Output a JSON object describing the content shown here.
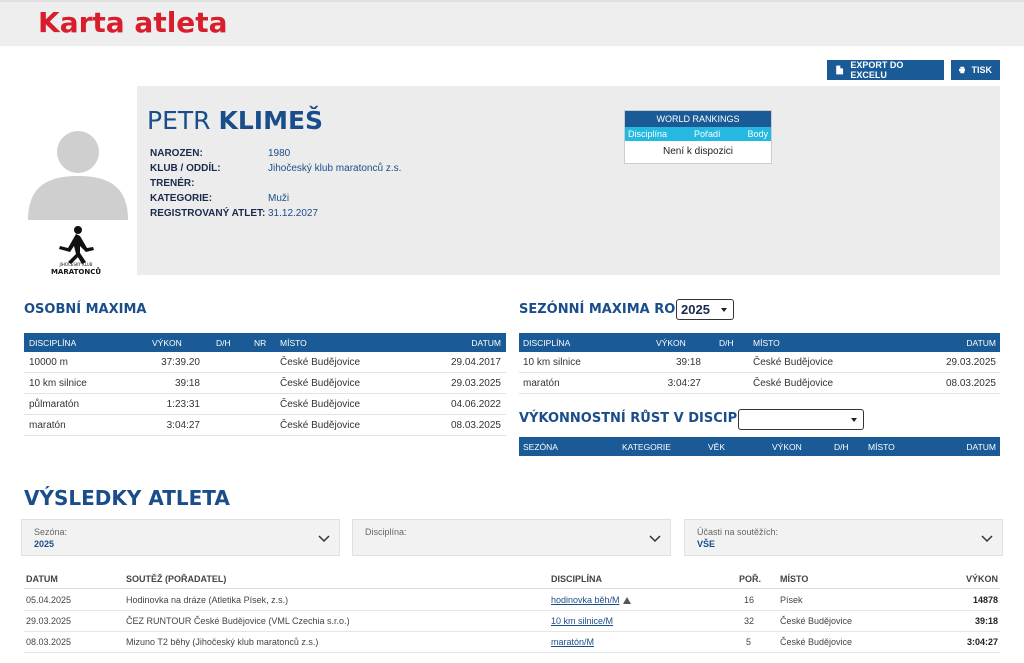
{
  "header": {
    "title": "Karta atleta"
  },
  "toolbar": {
    "export_label": "EXPORT DO EXCELU",
    "print_label": "TISK"
  },
  "athlete": {
    "first_name": "PETR",
    "last_name": "KLIMEŠ",
    "fields": [
      {
        "label": "NAROZEN:",
        "value": "1980"
      },
      {
        "label": "KLUB / ODDÍL:",
        "value": "Jihočeský klub maratonců z.s."
      },
      {
        "label": "TRENÉR:",
        "value": ""
      },
      {
        "label": "KATEGORIE:",
        "value": "Muži"
      },
      {
        "label": "REGISTROVANÝ ATLET:",
        "value": "31.12.2027"
      }
    ],
    "club_logo_text": [
      "JIHOČESKÝ KLUB",
      "MARATONCŮ"
    ]
  },
  "world_rankings": {
    "title": "WORLD RANKINGS",
    "columns": [
      "Disciplína",
      "Pořadí",
      "Body"
    ],
    "empty": "Není k dispozici"
  },
  "personal_bests": {
    "title": "OSOBNÍ MAXIMA",
    "columns": [
      "DISCIPLÍNA",
      "VÝKON",
      "D/H",
      "NR",
      "MÍSTO",
      "DATUM"
    ],
    "rows": [
      [
        "10000 m",
        "37:39.20",
        "",
        "",
        "České Budějovice",
        "29.04.2017"
      ],
      [
        "10 km silnice",
        "39:18",
        "",
        "",
        "České Budějovice",
        "29.03.2025"
      ],
      [
        "půlmaratón",
        "1:23:31",
        "",
        "",
        "České Budějovice",
        "04.06.2022"
      ],
      [
        "maratón",
        "3:04:27",
        "",
        "",
        "České Budějovice",
        "08.03.2025"
      ]
    ]
  },
  "season_bests": {
    "title": "SEZÓNNÍ MAXIMA ROKU",
    "year": "2025",
    "columns": [
      "DISCIPLÍNA",
      "VÝKON",
      "D/H",
      "MÍSTO",
      "DATUM"
    ],
    "rows": [
      [
        "10 km silnice",
        "39:18",
        "",
        "České Budějovice",
        "29.03.2025"
      ],
      [
        "maratón",
        "3:04:27",
        "",
        "České Budějovice",
        "08.03.2025"
      ]
    ]
  },
  "progress": {
    "title": "VÝKONNOSTNÍ RŮST V DISCIPLÍNĚ",
    "selected": "",
    "columns": [
      "SEZÓNA",
      "KATEGORIE",
      "VĚK",
      "VÝKON",
      "D/H",
      "MÍSTO",
      "DATUM"
    ]
  },
  "results": {
    "title": "VÝSLEDKY ATLETA",
    "filters": [
      {
        "label": "Sezóna:",
        "value": "2025"
      },
      {
        "label": "Disciplína:",
        "value": ""
      },
      {
        "label": "Účasti na soutěžích:",
        "value": "VŠE"
      }
    ],
    "columns": [
      "DATUM",
      "SOUTĚŽ (POŘADATEL)",
      "DISCIPLÍNA",
      "POŘ.",
      "MÍSTO",
      "VÝKON"
    ],
    "rows": [
      [
        "05.04.2025",
        "Hodinovka na dráze (Atletika Písek, z.s.)",
        "hodinovka běh/M",
        "16",
        "Písek",
        "14878"
      ],
      [
        "29.03.2025",
        "ČEZ RUNTOUR České Budějovice (VML Czechia s.r.o.)",
        "10 km silnice/M",
        "32",
        "České Budějovice",
        "39:18"
      ],
      [
        "08.03.2025",
        "Mizuno T2 běhy (Jihočeský klub maratonců z.s.)",
        "maratón/M",
        "5",
        "České Budějovice",
        "3:04:27"
      ]
    ]
  }
}
